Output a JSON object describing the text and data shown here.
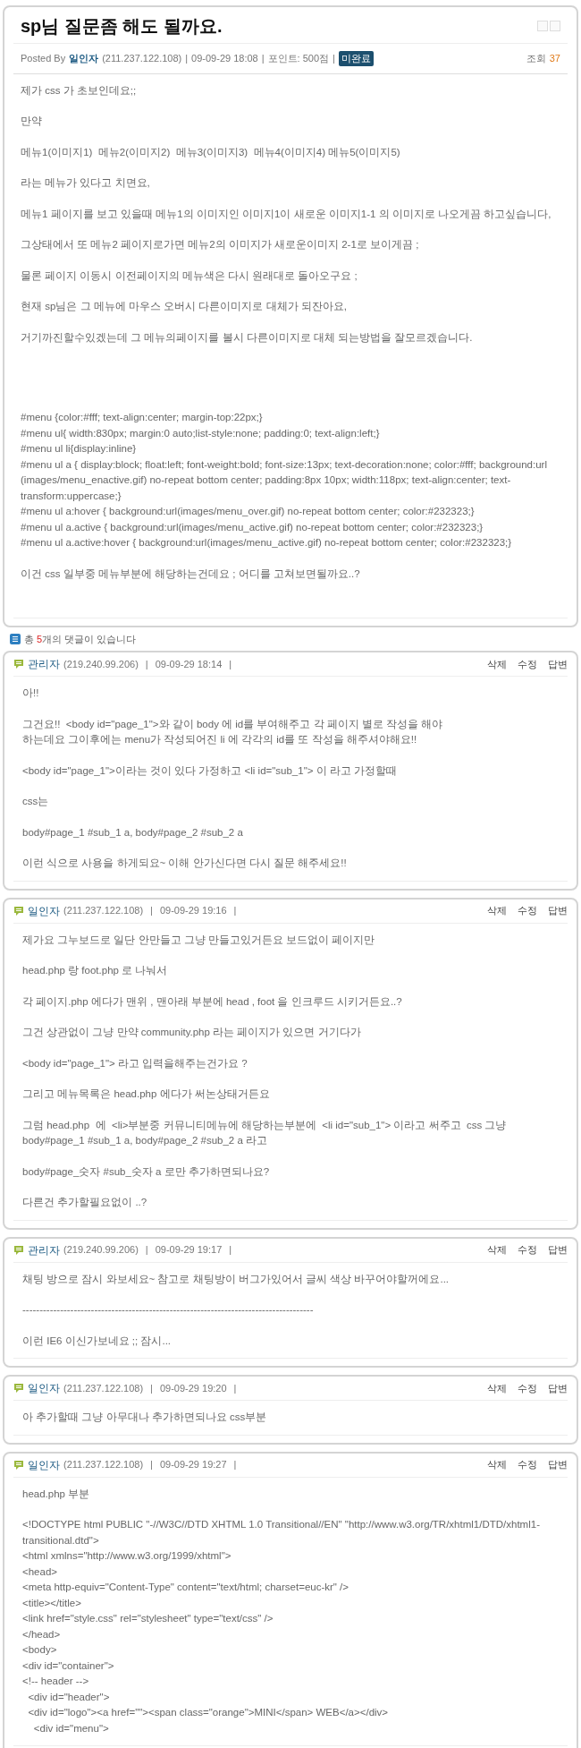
{
  "post": {
    "title": "sp님 질문좀 해도 될까요.",
    "posted_by_label": "Posted By",
    "author": "일인자",
    "ip": "(211.237.122.108)",
    "separator": "|",
    "date": "09-09-29 18:08",
    "points": "포인트: 500점",
    "status_badge": "미완료",
    "views_label": "조회",
    "views": "37",
    "body": [
      {
        "kind": "text",
        "lines": [
          "제가 css 가 초보인데요;;"
        ]
      },
      {
        "kind": "text",
        "lines": [
          "만약"
        ]
      },
      {
        "kind": "text",
        "lines": [
          "메뉴1(이미지1)  메뉴2(이미지2)  메뉴3(이미지3)  메뉴4(이미지4) 메뉴5(이미지5)"
        ]
      },
      {
        "kind": "text",
        "lines": [
          "라는 메뉴가 있다고 치면요,"
        ]
      },
      {
        "kind": "text",
        "lines": [
          "메뉴1 페이지를 보고 있을때 메뉴1의 이미지인 이미지1이 새로운 이미지1-1 의 이미지로 나오게끔 하고싶습니다,"
        ]
      },
      {
        "kind": "text",
        "lines": [
          "그상태에서 또 메뉴2 페이지로가면 메뉴2의 이미지가 새로운이미지 2-1로 보이게끔 ;"
        ]
      },
      {
        "kind": "text",
        "lines": [
          "물론 페이지 이동시 이전페이지의 메뉴색은 다시 원래대로 돌아오구요 ;"
        ]
      },
      {
        "kind": "text",
        "lines": [
          "현재 sp님은 그 메뉴에 마우스 오버시 다른이미지로 대체가 되잔아요,"
        ]
      },
      {
        "kind": "text",
        "lines": [
          "거기까진할수있겠는데 그 메뉴의페이지를 볼시 다른이미지로 대체 되는방법을 잘모르겠습니다."
        ]
      },
      {
        "kind": "code",
        "lines": [
          "#menu {color:#fff; text-align:center; margin-top:22px;}",
          "#menu ul{ width:830px; margin:0 auto;list-style:none; padding:0; text-align:left;}",
          "#menu ul li{display:inline}",
          "#menu ul a { display:block; float:left; font-weight:bold; font-size:13px; text-decoration:none; color:#fff; background:url (images/menu_enactive.gif) no-repeat bottom center; padding:8px 10px; width:118px; text-align:center; text-transform:uppercase;}",
          "#menu ul a:hover { background:url(images/menu_over.gif) no-repeat bottom center; color:#232323;}",
          "#menu ul a.active { background:url(images/menu_active.gif) no-repeat bottom center; color:#232323;}",
          "#menu ul a.active:hover { background:url(images/menu_active.gif) no-repeat bottom center; color:#232323;}"
        ]
      },
      {
        "kind": "text",
        "lines": [
          "이건 css 일부중 메뉴부분에 해당하는건데요 ; 어디를 고쳐보면될까요..?"
        ]
      }
    ]
  },
  "comment_count": {
    "prefix": "총 ",
    "count": "5",
    "suffix": "개의 댓글이 있습니다"
  },
  "comments": [
    {
      "author": "관리자",
      "ip": "(219.240.99.206)",
      "separator": "|",
      "date": "09-09-29 18:14",
      "actions": [
        "삭제",
        "수정",
        "답변"
      ],
      "body": [
        {
          "lines": [
            "아!!"
          ]
        },
        {
          "lines": [
            "그건요!!  <body id=\"page_1\">와 같이 body 에 id를 부여해주고 각 페이지 별로 작성을 해야",
            "하는데요 그이후에는 menu가 작성되어진 li 에 각각의 id를 또 작성을 해주셔야해요!!"
          ]
        },
        {
          "lines": [
            "<body id=\"page_1\">이라는 것이 있다 가정하고 <li id=\"sub_1\"> 이 라고 가정할때"
          ]
        },
        {
          "lines": [
            "css는"
          ]
        },
        {
          "lines": [
            "body#page_1 #sub_1 a, body#page_2 #sub_2 a"
          ]
        },
        {
          "lines": [
            "이런 식으로 사용을 하게되요~ 이해 안가신다면 다시 질문 해주세요!!"
          ]
        }
      ]
    },
    {
      "author": "일인자",
      "ip": "(211.237.122.108)",
      "separator": "|",
      "date": "09-09-29 19:16",
      "actions": [
        "삭제",
        "수정",
        "답변"
      ],
      "body": [
        {
          "lines": [
            "제가요 그누보드로 일단 안만들고 그냥 만들고있거든요 보드없이 페이지만"
          ]
        },
        {
          "lines": [
            "head.php 랑 foot.php 로 나눠서"
          ]
        },
        {
          "lines": [
            "각 페이지.php 에다가 맨위 , 맨아래 부분에 head , foot 을 인크루드 시키거든요..?"
          ]
        },
        {
          "lines": [
            "그건 상관없이 그냥 만약 community.php 라는 페이지가 있으면 거기다가"
          ]
        },
        {
          "lines": [
            "<body id=\"page_1\"> 라고 입력을해주는건가요 ?"
          ]
        },
        {
          "lines": [
            "그리고 메뉴목록은 head.php 에다가 써논상태거든요"
          ]
        },
        {
          "lines": [
            "그럼 head.php  에  <li>부분중 커뮤니티메뉴에 해당하는부분에  <li id=\"sub_1\"> 이라고 써주고  css 그냥 body#page_1 #sub_1 a, body#page_2 #sub_2 a 라고"
          ]
        },
        {
          "lines": [
            "body#page_숫자 #sub_숫자 a 로만 추가하면되나요?"
          ]
        },
        {
          "lines": [
            "다른건 추가할필요없이 ..?"
          ]
        }
      ]
    },
    {
      "author": "관리자",
      "ip": "(219.240.99.206)",
      "separator": "|",
      "date": "09-09-29 19:17",
      "actions": [
        "삭제",
        "수정",
        "답변"
      ],
      "body": [
        {
          "lines": [
            "채팅 방으로 잠시 와보세요~ 참고로 채팅방이 버그가있어서 글씨 색상 바꾸어야할꺼에요..."
          ]
        },
        {
          "lines": [
            "-------------------------------------------------------------------------------------"
          ]
        },
        {
          "lines": [
            "이런 IE6 이신가보네요 ;; 잠시..."
          ]
        }
      ]
    },
    {
      "author": "일인자",
      "ip": "(211.237.122.108)",
      "separator": "|",
      "date": "09-09-29 19:20",
      "actions": [
        "삭제",
        "수정",
        "답변"
      ],
      "body": [
        {
          "lines": [
            "아 추가할때 그냥 아무대나 추가하면되나요 css부분"
          ]
        }
      ]
    },
    {
      "author": "일인자",
      "ip": "(211.237.122.108)",
      "separator": "|",
      "date": "09-09-29 19:27",
      "actions": [
        "삭제",
        "수정",
        "답변"
      ],
      "body": [
        {
          "lines": [
            "head.php 부분"
          ]
        },
        {
          "lines": [
            "<!DOCTYPE html PUBLIC \"-//W3C//DTD XHTML 1.0 Transitional//EN\" \"http://www.w3.org/TR/xhtml1/DTD/xhtml1-transitional.dtd\">",
            "<html xmlns=\"http://www.w3.org/1999/xhtml\">",
            "<head>",
            "<meta http-equiv=\"Content-Type\" content=\"text/html; charset=euc-kr\" />",
            "<title></title>",
            "<link href=\"style.css\" rel=\"stylesheet\" type=\"text/css\" />",
            "</head>",
            "<body>",
            "<div id=\"container\">",
            "<!-- header -->",
            "  <div id=\"header\">",
            "  <div id=\"logo\"><a href=\"\"><span class=\"orange\">MINI</span> WEB</a></div>",
            "    <div id=\"menu\">"
          ]
        }
      ]
    }
  ]
}
